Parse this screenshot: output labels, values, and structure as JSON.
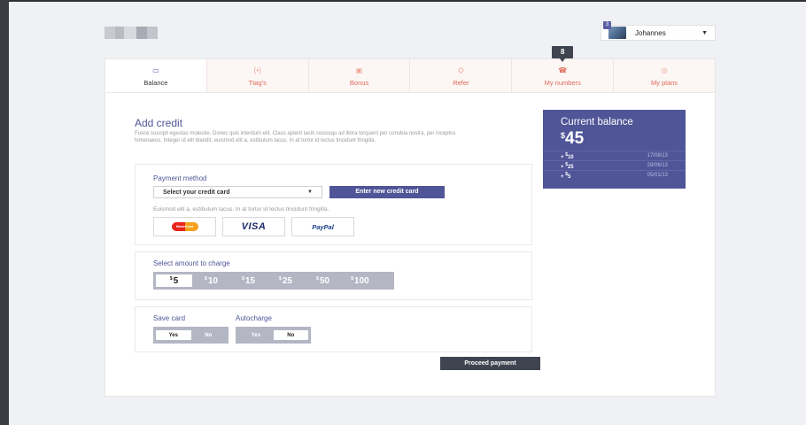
{
  "header": {
    "user_name": "Johannes",
    "notification_count": "3"
  },
  "tabs": [
    {
      "label": "Balance",
      "icon": "wallet-icon"
    },
    {
      "label": "Ttag's",
      "icon": "tag-icon"
    },
    {
      "label": "Bonus",
      "icon": "gift-icon"
    },
    {
      "label": "Refer",
      "icon": "refer-icon"
    },
    {
      "label": "My numbers",
      "icon": "phone-icon",
      "tooltip": "8"
    },
    {
      "label": "My plans",
      "icon": "plan-icon"
    }
  ],
  "add_credit": {
    "title": "Add credit",
    "description": "Fusce suscipit egestas molestie. Donec quis interdum elit. Class aptent taciti sociosqu ad litora torquent per conubia nostra, per inceptos himenaeos. Integer id elit blandit, euismod elit a,  estibulum lacus. In at tortor id lectus tincidunt fringilla."
  },
  "payment": {
    "title": "Payment method",
    "select_label": "Select your credit card",
    "new_card_label": "Enter new credit card",
    "note": "Euismod elit a,  estibulum lacus. In at tortor id lectus tincidunt fringilla.",
    "options": {
      "mastercard": "MasterCard",
      "visa": "VISA",
      "paypal": "PayPal"
    }
  },
  "amount": {
    "title": "Select amount to charge",
    "currency": "$",
    "options": [
      "5",
      "10",
      "15",
      "25",
      "50",
      "100"
    ],
    "selected": "5"
  },
  "settings": {
    "save_card": {
      "label": "Save card",
      "yes": "Yes",
      "no": "No",
      "value": "Yes"
    },
    "autocharge": {
      "label": "Autocharge",
      "yes": "Yes",
      "no": "No",
      "value": "No"
    }
  },
  "proceed_label": "Proceed payment",
  "balance": {
    "title": "Current balance",
    "currency": "$",
    "amount": "45",
    "history": [
      {
        "prefix": "+",
        "currency": "$",
        "amount": "10",
        "date": "17/08/13"
      },
      {
        "prefix": "+",
        "currency": "$",
        "amount": "25",
        "date": "28/06/13"
      },
      {
        "prefix": "+",
        "currency": "$",
        "amount": "5",
        "date": "05/01/13"
      }
    ]
  },
  "colors": {
    "primary": "#4f5597",
    "dark": "#3f4450",
    "tab_accent": "#e06a58"
  }
}
